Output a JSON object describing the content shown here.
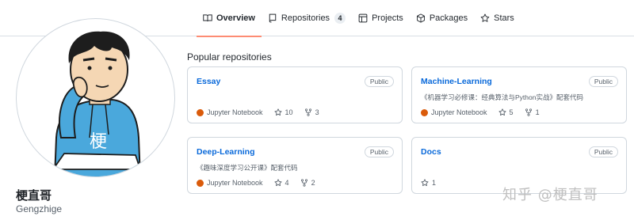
{
  "nav": {
    "tabs": [
      {
        "label": "Overview",
        "icon": "book-icon",
        "active": true
      },
      {
        "label": "Repositories",
        "icon": "repo-icon",
        "count": "4"
      },
      {
        "label": "Projects",
        "icon": "table-icon"
      },
      {
        "label": "Packages",
        "icon": "package-icon"
      },
      {
        "label": "Stars",
        "icon": "star-icon"
      }
    ],
    "active_underline_color": "#fd8c73"
  },
  "profile": {
    "name": "梗直哥",
    "login": "Gengzhige",
    "avatar_glyph": "梗"
  },
  "section_title": "Popular repositories",
  "repos": [
    {
      "name": "Essay",
      "visibility": "Public",
      "description": "",
      "language": "Jupyter Notebook",
      "language_color": "#DA5B0B",
      "stars": "10",
      "forks": "3"
    },
    {
      "name": "Machine-Learning",
      "visibility": "Public",
      "description": "《机器学习必修课：经典算法与Python实战》配套代码",
      "language": "Jupyter Notebook",
      "language_color": "#DA5B0B",
      "stars": "5",
      "forks": "1"
    },
    {
      "name": "Deep-Learning",
      "visibility": "Public",
      "description": "《趣味深度学习公开课》配套代码",
      "language": "Jupyter Notebook",
      "language_color": "#DA5B0B",
      "stars": "4",
      "forks": "2"
    },
    {
      "name": "Docs",
      "visibility": "Public",
      "description": "",
      "language": "",
      "stars": "1",
      "forks": ""
    }
  ],
  "watermark": "知乎 @梗直哥"
}
